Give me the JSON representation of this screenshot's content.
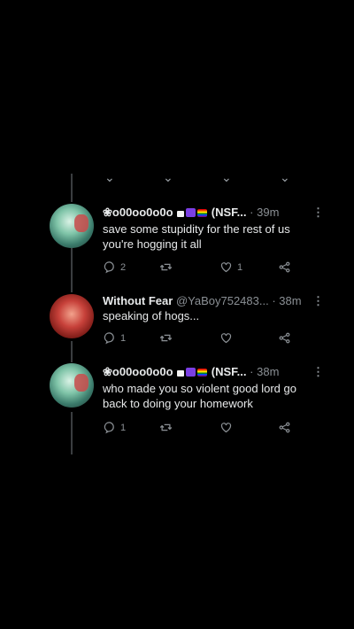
{
  "tweets": [
    {
      "name": "❀o00oo0o0o",
      "badges": [
        "white",
        "purple",
        "rainbow"
      ],
      "tail": "(NSF...",
      "handle": "",
      "time": "39m",
      "text": "save some stupidity for the rest of us you're hogging it all",
      "reply_count": "2",
      "retweet_count": "",
      "like_count": "1",
      "avatar": "anime"
    },
    {
      "name": "Without Fear",
      "badges": [],
      "tail": "",
      "handle": "@YaBoy752483...",
      "time": "38m",
      "text": "speaking of hogs...",
      "reply_count": "1",
      "retweet_count": "",
      "like_count": "",
      "avatar": "red"
    },
    {
      "name": "❀o00oo0o0o",
      "badges": [
        "white",
        "purple",
        "rainbow"
      ],
      "tail": "(NSF...",
      "handle": "",
      "time": "38m",
      "text": "who made you so violent good lord go back to doing your homework",
      "reply_count": "1",
      "retweet_count": "",
      "like_count": "",
      "avatar": "anime"
    }
  ],
  "ui": {
    "separator": "·",
    "more_icon": "⋮"
  },
  "icons": {
    "reply": "reply-icon",
    "retweet": "retweet-icon",
    "like": "heart-icon",
    "share": "share-icon"
  }
}
